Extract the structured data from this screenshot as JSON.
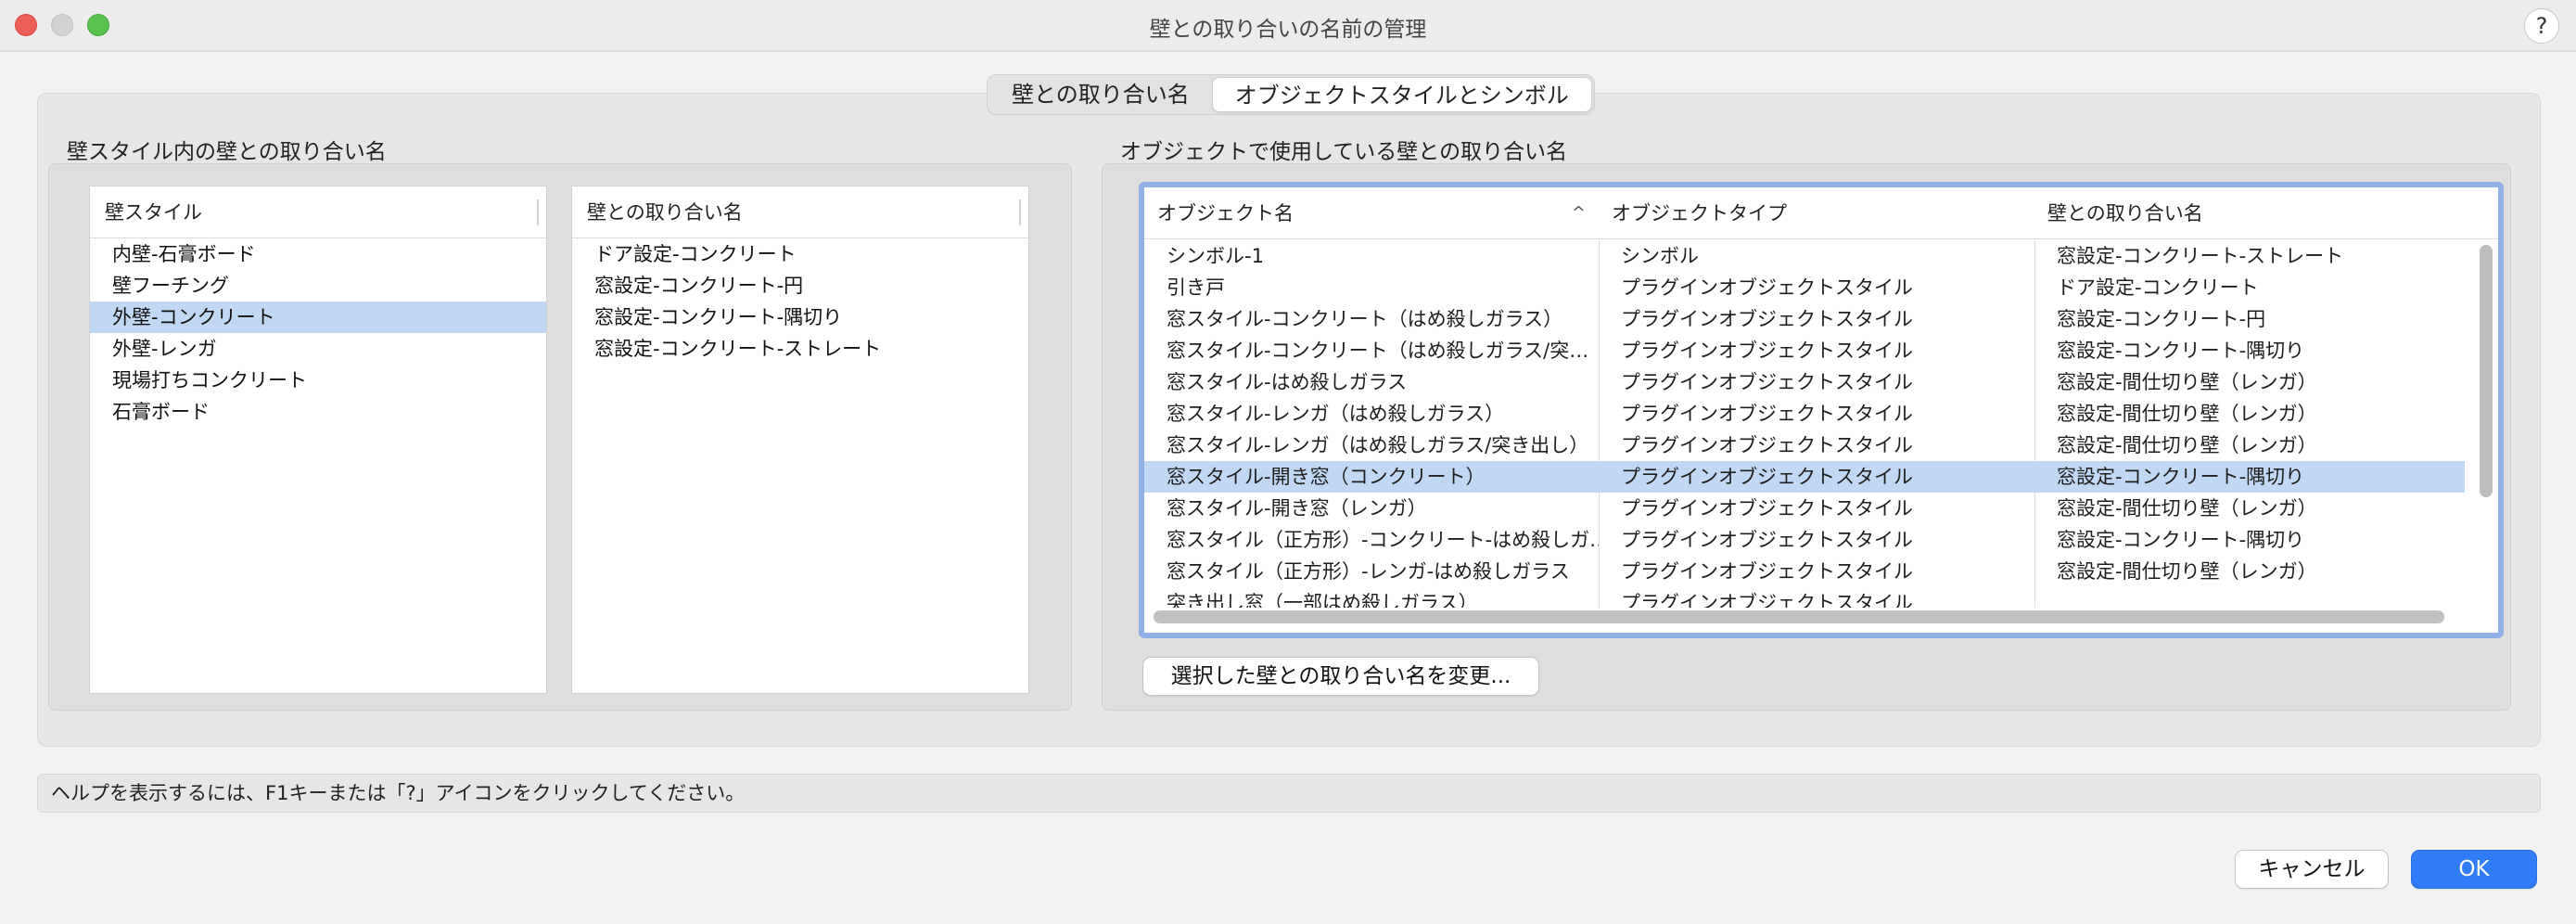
{
  "window": {
    "title": "壁との取り合いの名前の管理",
    "help_label": "?"
  },
  "tabs": [
    {
      "label": "壁との取り合い名",
      "active": false
    },
    {
      "label": "オブジェクトスタイルとシンボル",
      "active": true
    }
  ],
  "left_section": {
    "title": "壁スタイル内の壁との取り合い名",
    "styles_list": {
      "header": "壁スタイル",
      "items": [
        "内壁-石膏ボード",
        "壁フーチング",
        "外壁-コンクリート",
        "外壁-レンガ",
        "現場打ちコンクリート",
        "石膏ボード"
      ],
      "selected_index": 2
    },
    "junctions_list": {
      "header": "壁との取り合い名",
      "items": [
        "ドア設定-コンクリート",
        "窓設定-コンクリート-円",
        "窓設定-コンクリート-隅切り",
        "窓設定-コンクリート-ストレート"
      ]
    }
  },
  "right_section": {
    "title": "オブジェクトで使用している壁との取り合い名",
    "table": {
      "columns": [
        "オブジェクト名",
        "オブジェクトタイプ",
        "壁との取り合い名"
      ],
      "sort_indicator": "^",
      "rows": [
        [
          "シンボル-1",
          "シンボル",
          "窓設定-コンクリート-ストレート"
        ],
        [
          "引き戸",
          "プラグインオブジェクトスタイル",
          "ドア設定-コンクリート"
        ],
        [
          "窓スタイル-コンクリート（はめ殺しガラス）",
          "プラグインオブジェクトスタイル",
          "窓設定-コンクリート-円"
        ],
        [
          "窓スタイル-コンクリート（はめ殺しガラス/突…",
          "プラグインオブジェクトスタイル",
          "窓設定-コンクリート-隅切り"
        ],
        [
          "窓スタイル-はめ殺しガラス",
          "プラグインオブジェクトスタイル",
          "窓設定-間仕切り壁（レンガ）"
        ],
        [
          "窓スタイル-レンガ（はめ殺しガラス）",
          "プラグインオブジェクトスタイル",
          "窓設定-間仕切り壁（レンガ）"
        ],
        [
          "窓スタイル-レンガ（はめ殺しガラス/突き出し）",
          "プラグインオブジェクトスタイル",
          "窓設定-間仕切り壁（レンガ）"
        ],
        [
          "窓スタイル-開き窓（コンクリート）",
          "プラグインオブジェクトスタイル",
          "窓設定-コンクリート-隅切り"
        ],
        [
          "窓スタイル-開き窓（レンガ）",
          "プラグインオブジェクトスタイル",
          "窓設定-間仕切り壁（レンガ）"
        ],
        [
          "窓スタイル（正方形）-コンクリート-はめ殺しガ…",
          "プラグインオブジェクトスタイル",
          "窓設定-コンクリート-隅切り"
        ],
        [
          "窓スタイル（正方形）-レンガ-はめ殺しガラス",
          "プラグインオブジェクトスタイル",
          "窓設定-間仕切り壁（レンガ）"
        ],
        [
          "突き出し窓（一部はめ殺しガラス）",
          "プラグインオブジェクトスタイル",
          ""
        ]
      ],
      "selected_index": 7
    },
    "change_button": "選択した壁との取り合い名を変更..."
  },
  "status_text": "ヘルプを表示するには、F1キーまたは「?」アイコンをクリックしてください。",
  "footer": {
    "cancel": "キャンセル",
    "ok": "OK"
  },
  "colors": {
    "selection": "#c1d8f5",
    "focus_ring": "#8fb1e8",
    "primary_button": "#2f7cf6"
  }
}
